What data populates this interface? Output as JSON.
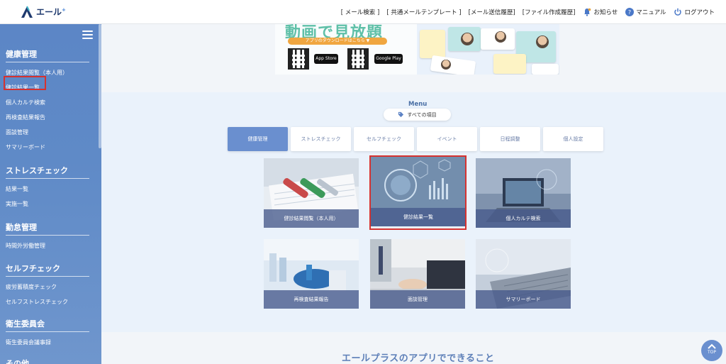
{
  "header": {
    "logo_text": "エール",
    "logo_sup": "+",
    "nav_links": [
      "[ メール検索 ]",
      "[ 共通メールテンプレート ]",
      "[メール送信履歴]",
      "[ファイル作成履歴]"
    ],
    "notice_label": "お知らせ",
    "manual_label": "マニュアル",
    "logout_label": "ログアウト"
  },
  "sidebar": {
    "sections": [
      {
        "title": "健康管理",
        "items": [
          "健診結果閲覧（本人用）",
          "健診結果一覧",
          "個人カルテ検索",
          "再検査結果報告",
          "面談管理",
          "サマリーボード"
        ]
      },
      {
        "title": "ストレスチェック",
        "items": [
          "結果一覧",
          "実施一覧"
        ]
      },
      {
        "title": "勤怠管理",
        "items": [
          "時間外労働管理"
        ]
      },
      {
        "title": "セルフチェック",
        "items": [
          "疲労蓄積度チェック",
          "セルフストレスチェック"
        ]
      },
      {
        "title": "衛生委員会",
        "items": [
          "衛生委員会議事録"
        ]
      },
      {
        "title": "その他"
      }
    ]
  },
  "banner": {
    "title": "動画で見放題",
    "download": "アプリのダウンロードはこちら ▼",
    "app_store": "App Store",
    "google_play": "Google Play"
  },
  "menu": {
    "label": "Menu",
    "all_items": "すべての項目",
    "tabs": [
      "健康管理",
      "ストレスチェック",
      "セルフチェック",
      "イベント",
      "日程調整",
      "個人設定"
    ],
    "cards": [
      "健診結果閲覧（本人用）",
      "健診結果一覧",
      "個人カルテ検索",
      "再検査結果報告",
      "面談管理",
      "サマリーボード"
    ]
  },
  "footer": {
    "title": "エールプラスのアプリでできること",
    "top_label": "TOP"
  },
  "colors": {
    "sidebar": "#5f8ac7",
    "accent": "#6a8fcf",
    "highlight": "#d6322f"
  }
}
